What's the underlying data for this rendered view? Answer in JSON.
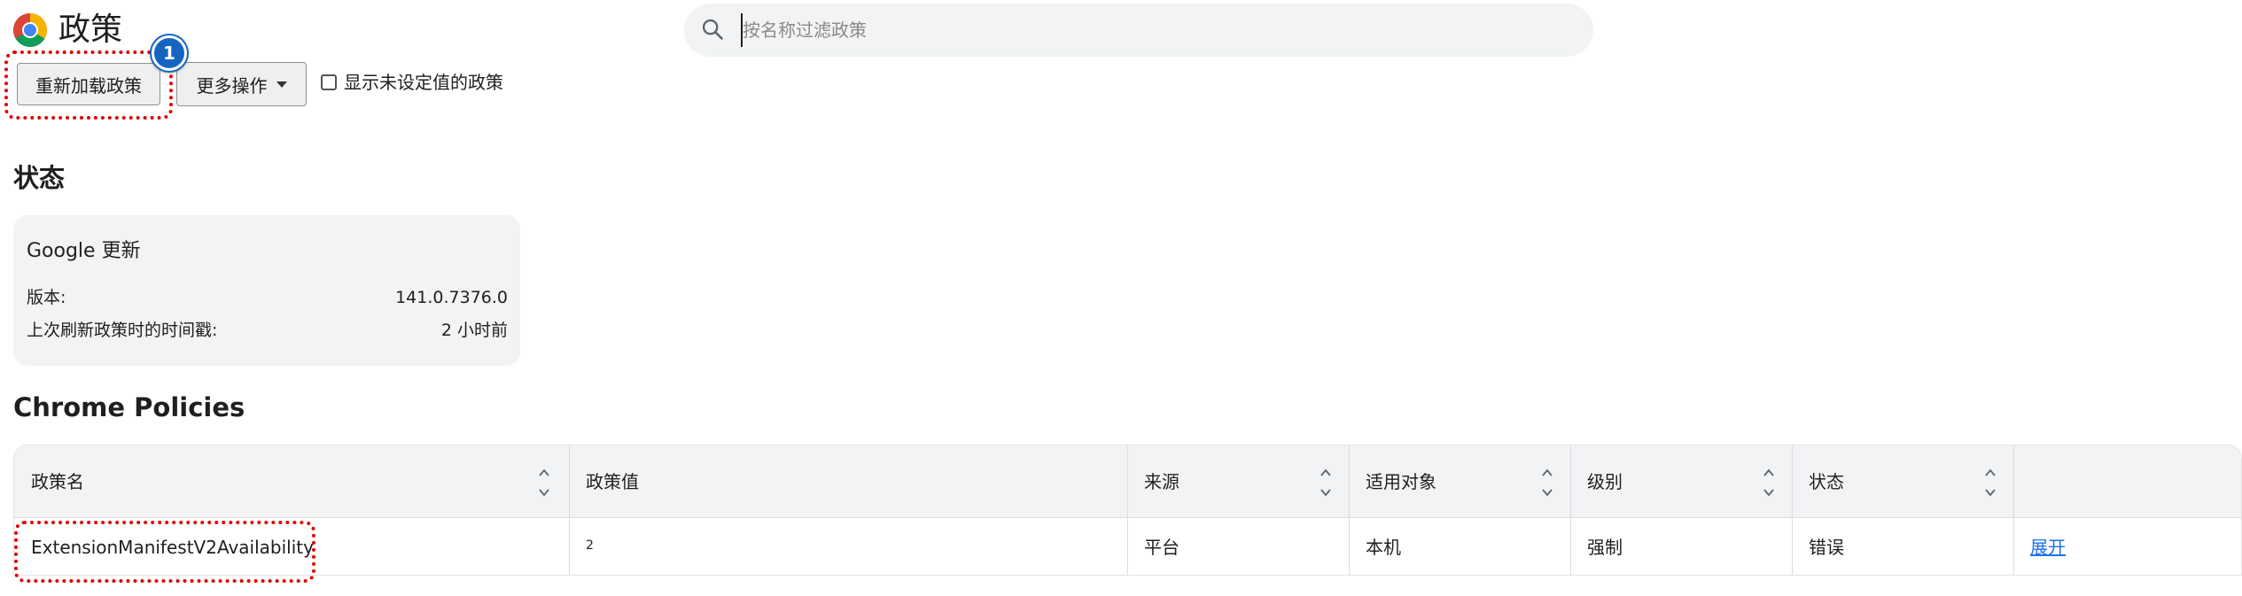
{
  "header": {
    "title": "政策",
    "logo_icon": "chrome-logo-icon",
    "search": {
      "placeholder": "按名称过滤政策",
      "value": ""
    }
  },
  "toolbar": {
    "reload_label": "重新加载政策",
    "more_actions_label": "更多操作",
    "show_unset_label": "显示未设定值的政策",
    "show_unset_checked": false
  },
  "annotations": {
    "badge_number": "1",
    "color": "#e00000",
    "badge_color": "#1565c0"
  },
  "status": {
    "heading": "状态",
    "card": {
      "title": "Google 更新",
      "rows": [
        {
          "label": "版本:",
          "value": "141.0.7376.0"
        },
        {
          "label": "上次刷新政策时的时间戳:",
          "value": "2 小时前"
        }
      ]
    }
  },
  "policies": {
    "heading": "Chrome Policies",
    "columns": [
      "政策名",
      "政策值",
      "来源",
      "适用对象",
      "级别",
      "状态",
      ""
    ],
    "rows": [
      {
        "name": "ExtensionManifestV2Availability",
        "value": "2",
        "source": "平台",
        "scope": "本机",
        "level": "强制",
        "status": "错误",
        "action": "展开"
      }
    ]
  },
  "colors": {
    "link": "#1a73e8",
    "panel_bg": "#f1f3f4"
  }
}
